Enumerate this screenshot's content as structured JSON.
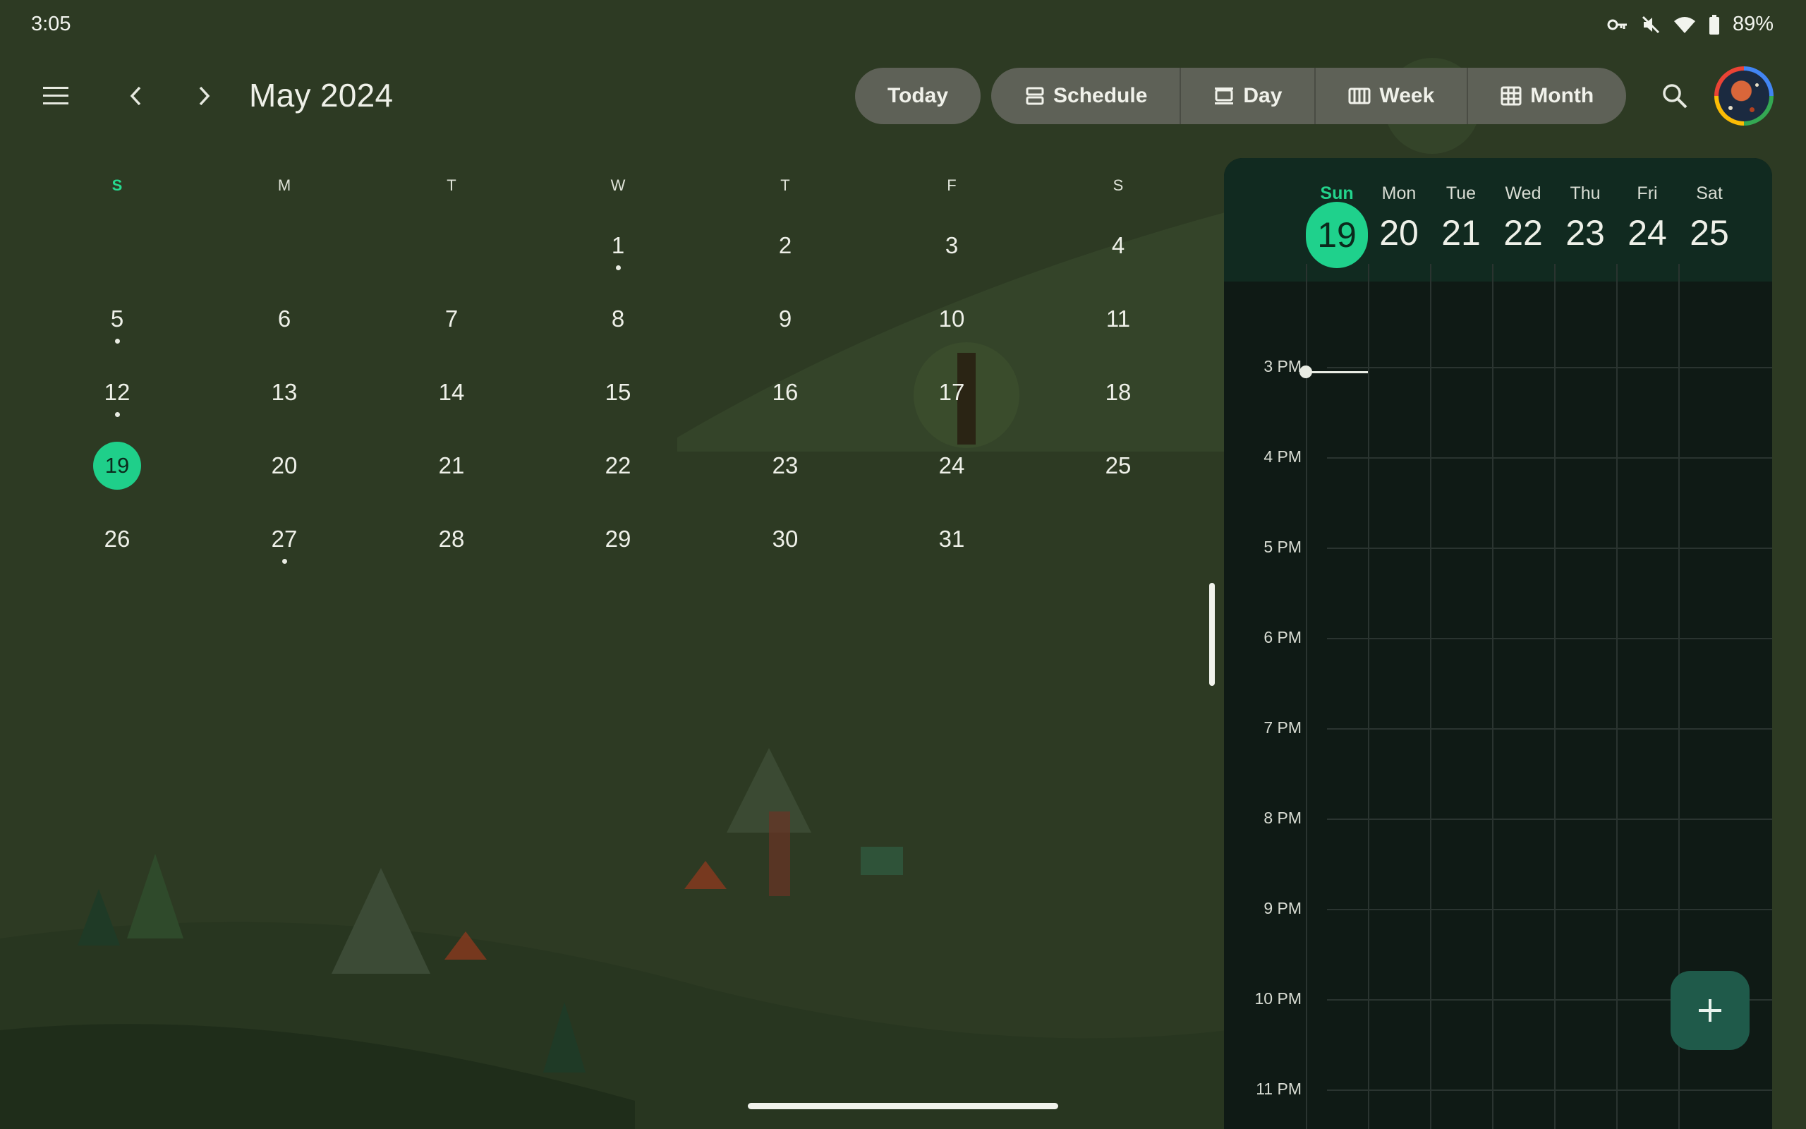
{
  "status_bar": {
    "time": "3:05",
    "battery": "89%",
    "icons": [
      "vpn-key-icon",
      "mute-icon",
      "wifi-icon",
      "battery-icon"
    ]
  },
  "toolbar": {
    "month_title": "May 2024",
    "today_label": "Today",
    "views": [
      {
        "label": "Schedule",
        "icon": "schedule-view-icon"
      },
      {
        "label": "Day",
        "icon": "day-view-icon"
      },
      {
        "label": "Week",
        "icon": "week-view-icon"
      },
      {
        "label": "Month",
        "icon": "month-view-icon"
      }
    ],
    "icons": [
      "menu-icon",
      "chevron-left-icon",
      "chevron-right-icon",
      "search-icon",
      "avatar"
    ]
  },
  "month": {
    "weekday_headers": [
      "S",
      "M",
      "T",
      "W",
      "T",
      "F",
      "S"
    ],
    "weeks": [
      [
        "",
        "",
        "",
        "1",
        "2",
        "3",
        "4"
      ],
      [
        "5",
        "6",
        "7",
        "8",
        "9",
        "10",
        "11"
      ],
      [
        "12",
        "13",
        "14",
        "15",
        "16",
        "17",
        "18"
      ],
      [
        "19",
        "20",
        "21",
        "22",
        "23",
        "24",
        "25"
      ],
      [
        "26",
        "27",
        "28",
        "29",
        "30",
        "31",
        ""
      ]
    ],
    "today": "19",
    "days_with_events": [
      "1",
      "5",
      "12",
      "27"
    ]
  },
  "week_view": {
    "days": [
      {
        "name": "Sun",
        "num": "19",
        "active": true
      },
      {
        "name": "Mon",
        "num": "20",
        "active": false
      },
      {
        "name": "Tue",
        "num": "21",
        "active": false
      },
      {
        "name": "Wed",
        "num": "22",
        "active": false
      },
      {
        "name": "Thu",
        "num": "23",
        "active": false
      },
      {
        "name": "Fri",
        "num": "24",
        "active": false
      },
      {
        "name": "Sat",
        "num": "25",
        "active": false
      }
    ],
    "hours": [
      "3 PM",
      "4 PM",
      "5 PM",
      "6 PM",
      "7 PM",
      "8 PM",
      "9 PM",
      "10 PM",
      "11 PM"
    ]
  },
  "colors": {
    "accent": "#1fcf8a",
    "background": "#2e3b24",
    "panel": "#0f1a15",
    "fab": "#1f5a4a"
  }
}
